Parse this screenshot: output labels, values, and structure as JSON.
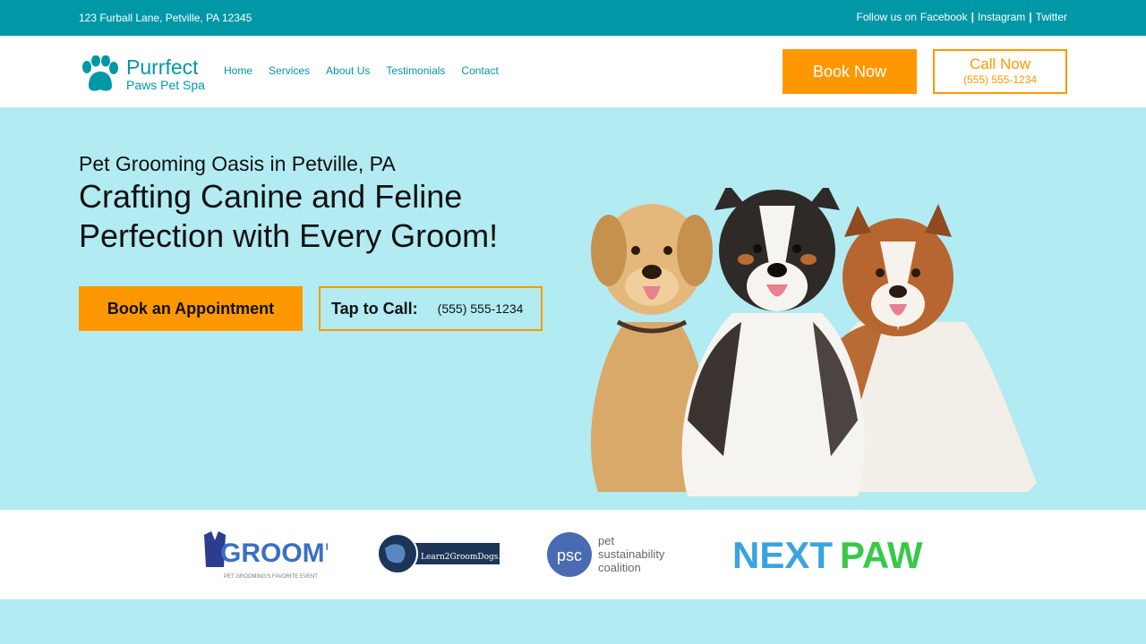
{
  "topbar": {
    "address": "123 Furball Lane, Petville, PA 12345",
    "follow_text": "Follow us on",
    "facebook": "Facebook",
    "instagram": "Instagram",
    "twitter": "Twitter",
    "separator": "|"
  },
  "brand": {
    "name": "Purrfect",
    "tagline": "Paws Pet Spa",
    "color": "#0097a7"
  },
  "nav": {
    "items": [
      "Home",
      "Services",
      "About Us",
      "Testimonials",
      "Contact"
    ]
  },
  "header_actions": {
    "book_label": "Book Now",
    "call_label": "Call Now",
    "call_phone": "(555) 555-1234"
  },
  "hero": {
    "kicker": "Pet Grooming Oasis in Petville, PA",
    "headline": "Crafting Canine and Feline Perfection with Every Groom!",
    "appointment_label": "Book an Appointment",
    "tap_label": "Tap to Call:",
    "tap_phone": "(555) 555-1234"
  },
  "partners": {
    "groomd": "GROOM'D",
    "groomd_tag": "PET GROOMING'S FAVORITE EVENT",
    "learn2": "Learn2GroomDogs.com",
    "psc_abbrev": "psc",
    "psc_line1": "pet",
    "psc_line2": "sustainability",
    "psc_line3": "coalition",
    "nextpaw_a": "NEXT",
    "nextpaw_b": "PAW"
  },
  "colors": {
    "teal": "#0097a7",
    "light_teal": "#b2ebf2",
    "orange": "#ff9800"
  },
  "icons": {
    "logo": "paw-icon",
    "hero_image": "three-dogs-illustration"
  }
}
